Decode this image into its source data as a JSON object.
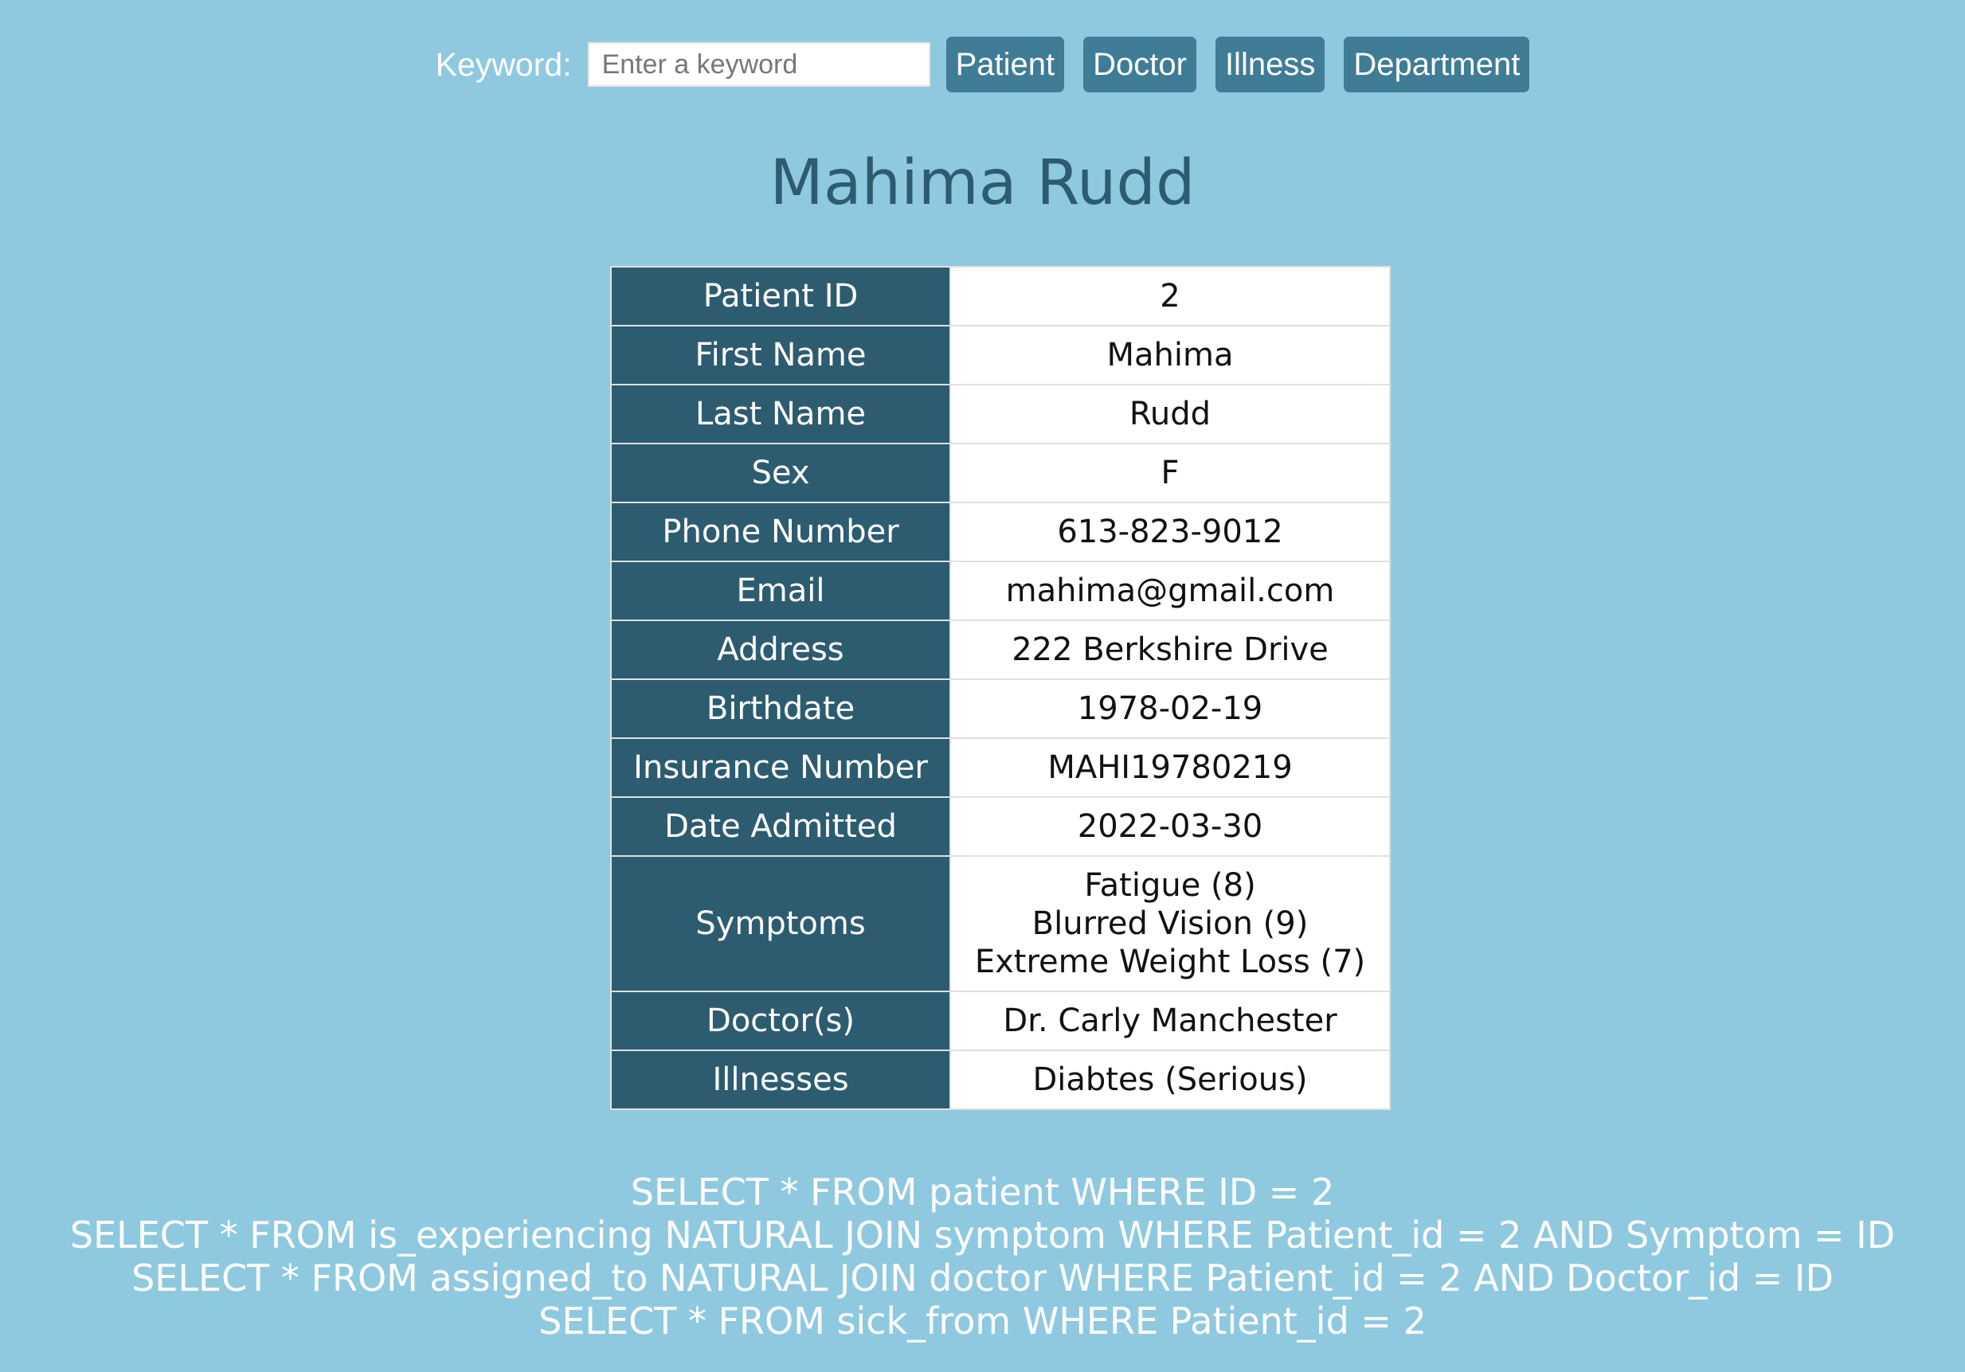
{
  "search": {
    "label": "Keyword:",
    "placeholder": "Enter a keyword",
    "value": ""
  },
  "nav": {
    "patient": "Patient",
    "doctor": "Doctor",
    "illness": "Illness",
    "department": "Department"
  },
  "page": {
    "title": "Mahima Rudd"
  },
  "patient": {
    "rows": [
      {
        "label": "Patient ID",
        "value": "2"
      },
      {
        "label": "First Name",
        "value": "Mahima"
      },
      {
        "label": "Last Name",
        "value": "Rudd"
      },
      {
        "label": "Sex",
        "value": "F"
      },
      {
        "label": "Phone Number",
        "value": "613-823-9012"
      },
      {
        "label": "Email",
        "value": "mahima@gmail.com"
      },
      {
        "label": "Address",
        "value": "222 Berkshire Drive"
      },
      {
        "label": "Birthdate",
        "value": "1978-02-19"
      },
      {
        "label": "Insurance Number",
        "value": "MAHI19780219"
      },
      {
        "label": "Date Admitted",
        "value": "2022-03-30"
      }
    ],
    "symptoms": {
      "label": "Symptoms",
      "values": [
        "Fatigue (8)",
        "Blurred Vision (9)",
        "Extreme Weight Loss (7)"
      ]
    },
    "doctors": {
      "label": "Doctor(s)",
      "value": "Dr. Carly Manchester"
    },
    "illnesses": {
      "label": "Illnesses",
      "value": "Diabtes (Serious)"
    }
  },
  "queries": [
    "SELECT * FROM patient WHERE ID = 2",
    "SELECT * FROM is_experiencing NATURAL JOIN symptom WHERE Patient_id = 2 AND Symptom = ID",
    "SELECT * FROM assigned_to NATURAL JOIN doctor WHERE Patient_id = 2 AND Doctor_id = ID",
    "SELECT * FROM sick_from WHERE Patient_id = 2"
  ],
  "colors": {
    "background": "#8fc9e0",
    "button": "#3f7c96",
    "header_cell": "#2d5c70",
    "title": "#2d5c72"
  }
}
